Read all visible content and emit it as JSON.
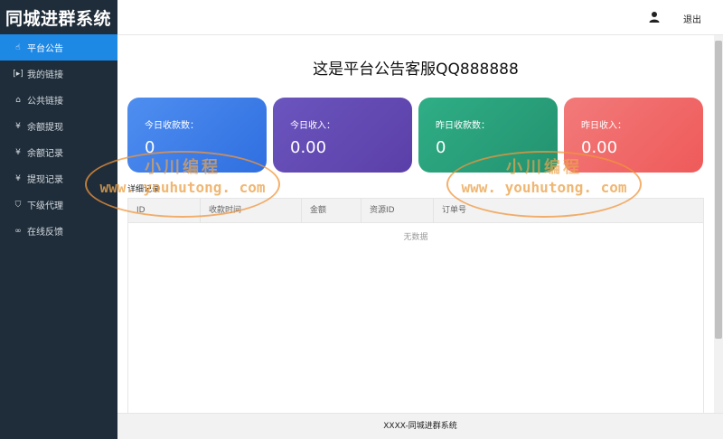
{
  "brand": "同城进群系统",
  "sidebar": {
    "items": [
      {
        "label": "平台公告",
        "icon": "hand-pointer-icon",
        "glyph": "☝",
        "active": true
      },
      {
        "label": "我的链接",
        "icon": "link-bracket-icon",
        "glyph": "[▸]",
        "active": false
      },
      {
        "label": "公共链接",
        "icon": "home-icon",
        "glyph": "⌂",
        "active": false
      },
      {
        "label": "余额提现",
        "icon": "yen-icon",
        "glyph": "¥",
        "active": false
      },
      {
        "label": "余额记录",
        "icon": "yen-icon",
        "glyph": "¥",
        "active": false
      },
      {
        "label": "提现记录",
        "icon": "yen-icon",
        "glyph": "¥",
        "active": false
      },
      {
        "label": "下级代理",
        "icon": "shield-check-icon",
        "glyph": "⛉",
        "active": false
      },
      {
        "label": "在线反馈",
        "icon": "infinity-icon",
        "glyph": "∞",
        "active": false
      }
    ]
  },
  "header": {
    "user_icon": "user-icon",
    "logout_label": "退出"
  },
  "main": {
    "notice": "这是平台公告客服QQ888888",
    "cards": [
      {
        "label": "今日收款数：",
        "value": "0"
      },
      {
        "label": "今日收入：",
        "value": "0.00"
      },
      {
        "label": "昨日收款数：",
        "value": "0"
      },
      {
        "label": "昨日收入：",
        "value": "0.00"
      }
    ],
    "section_title": "详细记录",
    "table": {
      "columns": [
        "ID",
        "收款时间",
        "金额",
        "资源ID",
        "订单号"
      ],
      "empty_text": "无数据"
    }
  },
  "footer": "XXXX-同城进群系统",
  "watermark": {
    "text_cn": "小川编程",
    "text_url": "www. youhutong. com"
  },
  "colors": {
    "sidebar_bg": "#1f2d3a",
    "active_item": "#1e88e5",
    "card_blue": "#3a7ce8",
    "card_purple": "#6249b2",
    "card_green": "#28a07b",
    "card_red": "#f06464"
  }
}
